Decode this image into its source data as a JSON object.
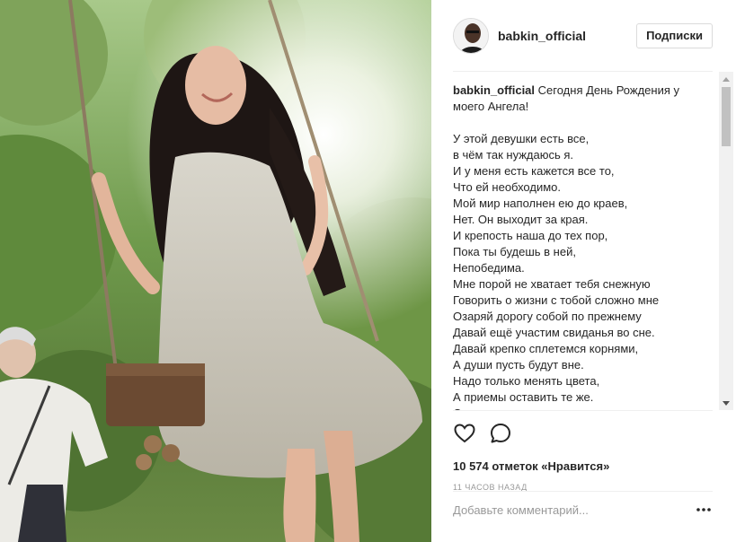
{
  "post": {
    "username": "babkin_official",
    "follow_label": "Подписки"
  },
  "caption": {
    "username": "babkin_official",
    "intro": "Сегодня День Рождения у моего Ангела!",
    "poem": "У этой девушки есть все,\nв чём так нуждаюсь я.\nИ у меня есть кажется все то,\nЧто ей необходимо.\nМой мир наполнен ею до краев,\nНет. Он выходит за края.\nИ крепость наша до тех пор,\nПока ты будешь в ней,\nНепобедима.\nМне порой не хватает тебя снежную\nГоворить о жизни с тобой сложно мне\nОзаряй дорогу собой по прежнему\nДавай ещё участим свиданья во сне.\nДавай крепко сплетемся корнями,\nА души пусть будут вне.\nНадо только менять цвета,\nА приемы оставить те же.\nСнова"
  },
  "actions": {
    "like_icon": "heart-icon",
    "comment_icon": "comment-icon",
    "likes_text": "10 574 отметок «Нравится»",
    "timestamp": "11 ЧАСОВ НАЗАД"
  },
  "comment": {
    "placeholder": "Добавьте комментарий...",
    "more_icon": "more-options-icon"
  },
  "colors": {
    "text": "#262626",
    "muted": "#999999",
    "border": "#efefef"
  }
}
